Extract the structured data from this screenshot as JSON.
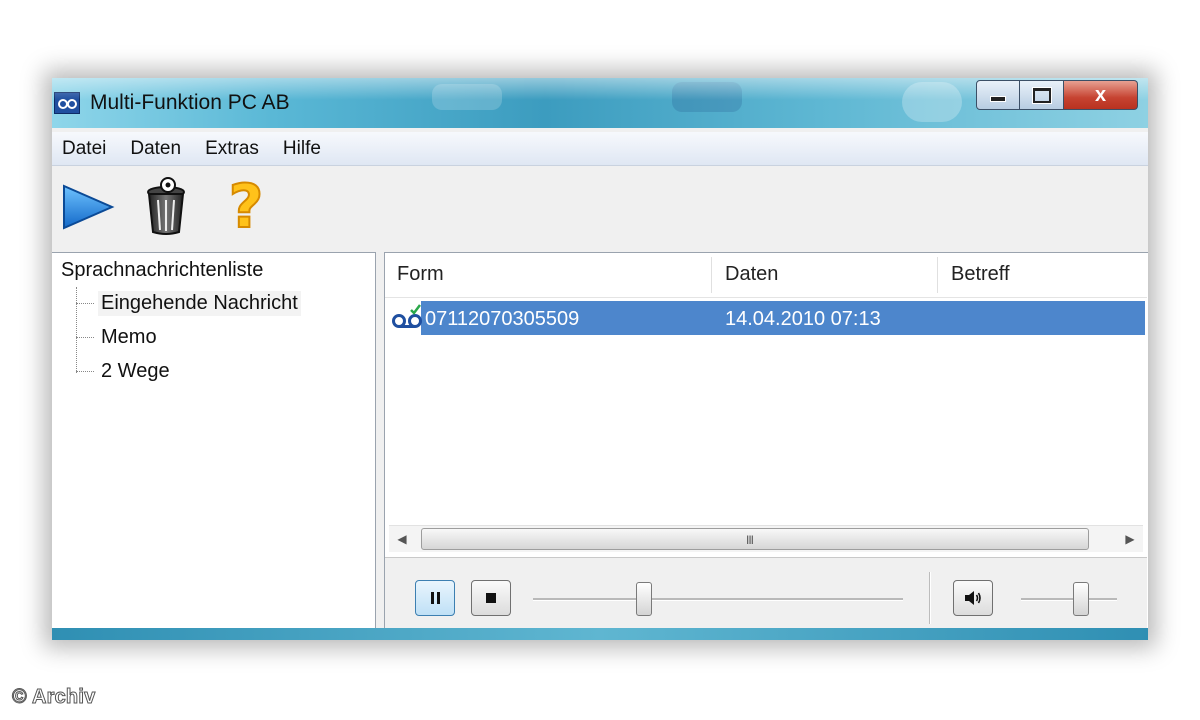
{
  "window": {
    "title": "Multi-Funktion PC AB",
    "close_glyph": "x",
    "app_icon": "voicemail-icon"
  },
  "menu": [
    "Datei",
    "Daten",
    "Extras",
    "Hilfe"
  ],
  "toolbar": {
    "tools": [
      {
        "name": "play",
        "icon": "play-icon"
      },
      {
        "name": "delete",
        "icon": "trash-icon"
      },
      {
        "name": "help",
        "icon": "help-icon",
        "glyph": "?"
      }
    ]
  },
  "tree": {
    "root": "Sprachnachrichtenliste",
    "items": [
      "Eingehende Nachricht",
      "Memo",
      "2 Wege"
    ],
    "selected_index": 0
  },
  "list": {
    "columns": [
      "Form",
      "Daten",
      "Betreff"
    ],
    "rows": [
      {
        "form": "07112070305509",
        "daten": "14.04.2010 07:13",
        "betreff": ""
      }
    ],
    "scrollbar": {
      "left_arrow": "◀",
      "right_arrow": "▶",
      "grip": "III"
    }
  },
  "player": {
    "progress": 0.3,
    "volume": 0.62
  },
  "colors": {
    "selection": "#4d86cc",
    "titlebar": "#3c9cbf",
    "help_icon": "#ffc21a"
  },
  "copyright": "© Archiv"
}
